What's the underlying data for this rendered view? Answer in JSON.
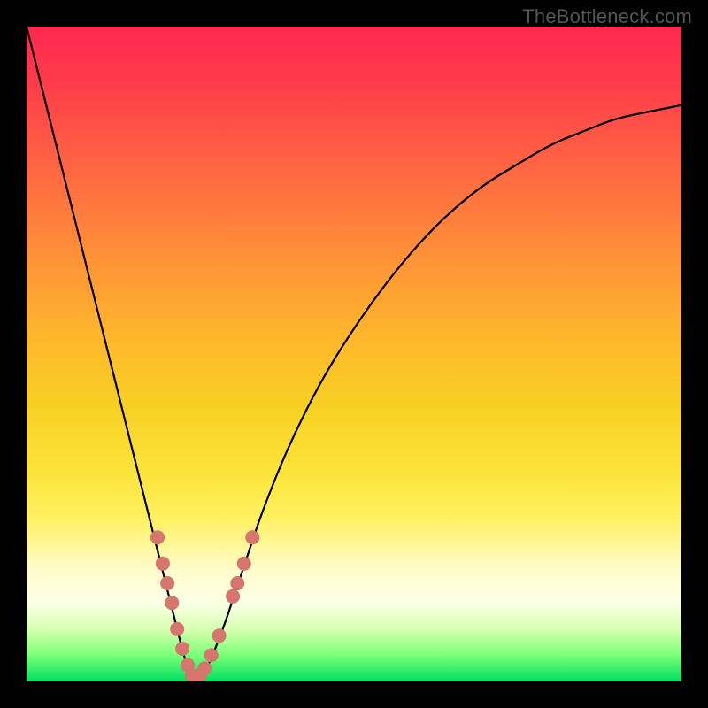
{
  "attribution": "TheBottleneck.com",
  "colors": {
    "background": "#000000",
    "gradient_top": "#ff2850",
    "gradient_bottom": "#00e060",
    "curve": "#000000",
    "markers": "#d6766f"
  },
  "chart_data": {
    "type": "line",
    "title": "",
    "xlabel": "",
    "ylabel": "",
    "xlim": [
      0,
      100
    ],
    "ylim": [
      0,
      100
    ],
    "grid": false,
    "legend": false,
    "series": [
      {
        "name": "curve",
        "x": [
          0,
          2,
          4,
          6,
          8,
          10,
          12,
          14,
          16,
          18,
          20,
          22,
          23,
          24,
          25,
          26,
          27,
          28,
          30,
          32,
          34,
          36,
          40,
          45,
          50,
          55,
          60,
          65,
          70,
          75,
          80,
          85,
          90,
          95,
          100
        ],
        "y": [
          100,
          92,
          84,
          76,
          68,
          60,
          52,
          44,
          36,
          28,
          20,
          12,
          8,
          4,
          1,
          0,
          1,
          3,
          8,
          14,
          20,
          26,
          36,
          46,
          54,
          61,
          67,
          72,
          76,
          79,
          82,
          84,
          86,
          87,
          88
        ]
      }
    ],
    "markers": [
      {
        "x": 20.0,
        "y": 22
      },
      {
        "x": 20.8,
        "y": 18
      },
      {
        "x": 21.5,
        "y": 15
      },
      {
        "x": 22.2,
        "y": 12
      },
      {
        "x": 23.0,
        "y": 8
      },
      {
        "x": 23.8,
        "y": 5
      },
      {
        "x": 24.6,
        "y": 2.5
      },
      {
        "x": 25.2,
        "y": 1
      },
      {
        "x": 25.8,
        "y": 0.5
      },
      {
        "x": 26.5,
        "y": 1
      },
      {
        "x": 27.2,
        "y": 2
      },
      {
        "x": 28.2,
        "y": 4
      },
      {
        "x": 29.4,
        "y": 7
      },
      {
        "x": 31.5,
        "y": 13
      },
      {
        "x": 32.2,
        "y": 15
      },
      {
        "x": 33.2,
        "y": 18
      },
      {
        "x": 34.5,
        "y": 22
      }
    ]
  }
}
